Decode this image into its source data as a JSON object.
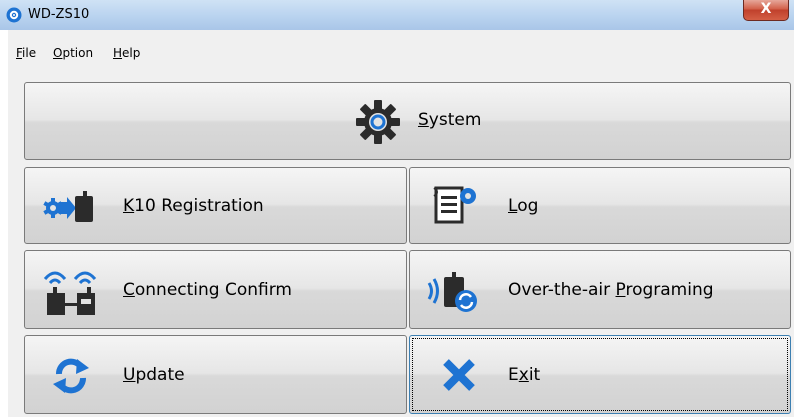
{
  "window": {
    "title": "WD-ZS10",
    "close_label": "X"
  },
  "menu": [
    {
      "pre": "",
      "key": "F",
      "post": "ile"
    },
    {
      "pre": "",
      "key": "O",
      "post": "ption"
    },
    {
      "pre": "",
      "key": "H",
      "post": "elp"
    }
  ],
  "buttons": {
    "system": {
      "pre": "",
      "key": "S",
      "post": "ystem"
    },
    "k10": {
      "pre": "",
      "key": "K",
      "post": "10 Registration"
    },
    "log": {
      "pre": "",
      "key": "L",
      "post": "og"
    },
    "connecting": {
      "pre": "",
      "key": "C",
      "post": "onnecting Confirm"
    },
    "ota": {
      "pre": "Over-the-air ",
      "key": "P",
      "post": "rograming"
    },
    "update": {
      "pre": "",
      "key": "U",
      "post": "pdate"
    },
    "exit": {
      "pre": "E",
      "key": "x",
      "post": "it"
    }
  },
  "colors": {
    "icon_blue": "#1e73d2",
    "icon_dark": "#2b2b2b",
    "close_red": "#c8452f"
  }
}
